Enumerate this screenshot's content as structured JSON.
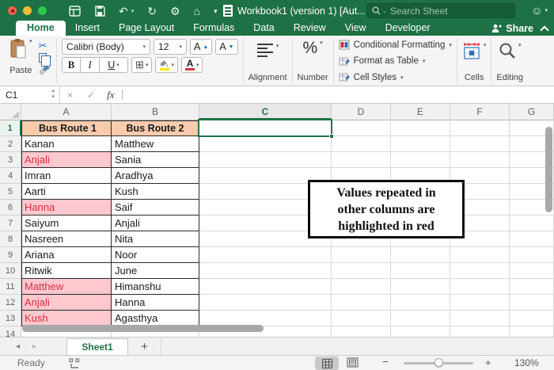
{
  "titlebar": {
    "title": "Workbook1 (version 1) [Aut...",
    "search_placeholder": "Search Sheet",
    "icons": {
      "workbook": "⊞",
      "save": "⎙",
      "undo": "↶",
      "redo": "↻",
      "settings": "⚙",
      "home": "⌂",
      "collapse": "▾",
      "smiley": "☺"
    }
  },
  "tabs": {
    "items": [
      "Home",
      "Insert",
      "Page Layout",
      "Formulas",
      "Data",
      "Review",
      "View",
      "Developer"
    ],
    "active": "Home",
    "share_label": "Share"
  },
  "ribbon": {
    "paste_label": "Paste",
    "font_name": "Calibri (Body)",
    "font_size": "12",
    "grow_font": "A",
    "shrink_font": "A",
    "bold": "B",
    "italic": "I",
    "underline": "U",
    "borders_glyph": "⊞",
    "font_color_glyph": "A",
    "alignment_label": "Alignment",
    "number_symbol": "%",
    "number_label": "Number",
    "styles": [
      "Conditional Formatting",
      "Format as Table",
      "Cell Styles"
    ],
    "cells_label": "Cells",
    "editing_label": "Editing"
  },
  "formula_bar": {
    "name_box": "C1",
    "cancel": "×",
    "enter": "✓",
    "fx_label": "fx"
  },
  "sheet": {
    "columns": [
      "A",
      "B",
      "C",
      "D",
      "E",
      "F",
      "G"
    ],
    "selected_column": "C",
    "selected_cell": "C1",
    "rows": [
      {
        "n": "1",
        "a": "Bus Route 1",
        "b": "Bus Route 2",
        "type": "header",
        "bordered": true
      },
      {
        "n": "2",
        "a": "Kanan",
        "b": "Matthew",
        "bordered": true
      },
      {
        "n": "3",
        "a": "Anjali",
        "b": "Sania",
        "bordered": true,
        "a_hl": true
      },
      {
        "n": "4",
        "a": "Imran",
        "b": "Aradhya",
        "bordered": true
      },
      {
        "n": "5",
        "a": "Aarti",
        "b": "Kush",
        "bordered": true
      },
      {
        "n": "6",
        "a": "Hanna",
        "b": "Saif",
        "bordered": true,
        "a_hl": true
      },
      {
        "n": "7",
        "a": "Saiyum",
        "b": "Anjali",
        "bordered": true
      },
      {
        "n": "8",
        "a": "Nasreen",
        "b": "Nita",
        "bordered": true
      },
      {
        "n": "9",
        "a": "Ariana",
        "b": "Noor",
        "bordered": true
      },
      {
        "n": "10",
        "a": "Ritwik",
        "b": "June",
        "bordered": true
      },
      {
        "n": "11",
        "a": "Matthew",
        "b": "Himanshu",
        "bordered": true,
        "a_hl": true
      },
      {
        "n": "12",
        "a": "Anjali",
        "b": "Hanna",
        "bordered": true,
        "a_hl": true
      },
      {
        "n": "13",
        "a": "Kush",
        "b": "Agasthya",
        "bordered": true,
        "a_hl": true
      },
      {
        "n": "14",
        "a": "",
        "b": ""
      }
    ],
    "annotation_lines": [
      "Values repeated in",
      "other columns are",
      "highlighted in red"
    ],
    "colors": {
      "header_fill": "#F8CBAD",
      "highlight_fill": "#FFC7CE",
      "highlight_text": "#CF3340",
      "selection": "#217346"
    }
  },
  "sheet_tabs": {
    "items": [
      "Sheet1"
    ],
    "active": "Sheet1",
    "add_label": "+"
  },
  "status_bar": {
    "mode": "Ready",
    "zoom": "130%"
  }
}
